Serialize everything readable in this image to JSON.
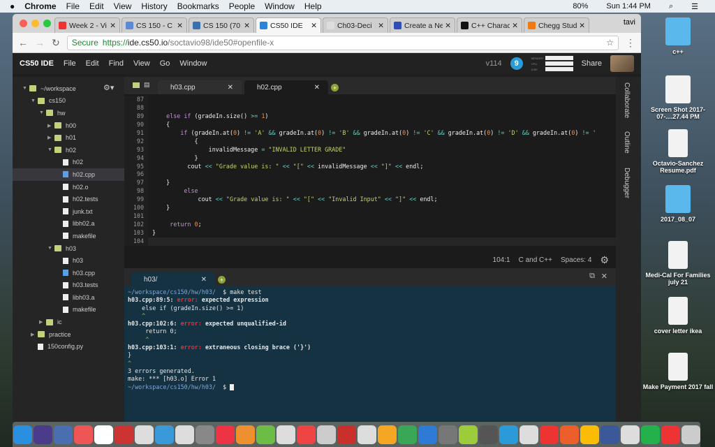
{
  "menubar": {
    "app": "Chrome",
    "items": [
      "File",
      "Edit",
      "View",
      "History",
      "Bookmarks",
      "People",
      "Window",
      "Help"
    ],
    "battery": "80%",
    "clock": "Sun 1:44 PM"
  },
  "browser": {
    "tabs": [
      {
        "title": "Week 2 - Vi",
        "color": "#e33"
      },
      {
        "title": "CS 150 - C",
        "color": "#5b8ad6"
      },
      {
        "title": "CS 150 (70",
        "color": "#3a6fb0"
      },
      {
        "title": "CS50 IDE",
        "color": "#2b83d8",
        "active": true
      },
      {
        "title": "Ch03-Deci",
        "color": "#ddd"
      },
      {
        "title": "Create a Ne",
        "color": "#2f4fb8"
      },
      {
        "title": "C++ Charac",
        "color": "#111"
      },
      {
        "title": "Chegg Stud",
        "color": "#f07a10"
      }
    ],
    "profile": "tavi",
    "secure": "Secure",
    "url_scheme": "https://",
    "url_host": "ide.cs50.io",
    "url_path": "/soctavio98/ide50#openfile-x"
  },
  "ide": {
    "brand": "CS50 IDE",
    "menu": [
      "File",
      "Edit",
      "Find",
      "View",
      "Go",
      "Window"
    ],
    "version": "v114",
    "badge": "9",
    "meters": [
      "MEMORY",
      "CPU",
      "DISK"
    ],
    "share": "Share"
  },
  "tree": [
    {
      "d": 0,
      "a": "▼",
      "t": "folder",
      "label": "~/workspace"
    },
    {
      "d": 1,
      "a": "▼",
      "t": "folder",
      "label": "cs150"
    },
    {
      "d": 2,
      "a": "▼",
      "t": "folder",
      "label": "hw"
    },
    {
      "d": 3,
      "a": "▶",
      "t": "folder",
      "label": "h00"
    },
    {
      "d": 3,
      "a": "▶",
      "t": "folder",
      "label": "h01"
    },
    {
      "d": 3,
      "a": "▼",
      "t": "folder",
      "label": "h02"
    },
    {
      "d": 4,
      "a": "",
      "t": "file",
      "label": "h02"
    },
    {
      "d": 4,
      "a": "",
      "t": "cppfile",
      "label": "h02.cpp",
      "sel": true
    },
    {
      "d": 4,
      "a": "",
      "t": "file",
      "label": "h02.o"
    },
    {
      "d": 4,
      "a": "",
      "t": "file",
      "label": "h02.tests"
    },
    {
      "d": 4,
      "a": "",
      "t": "file",
      "label": "junk.txt"
    },
    {
      "d": 4,
      "a": "",
      "t": "file",
      "label": "libh02.a"
    },
    {
      "d": 4,
      "a": "",
      "t": "file",
      "label": "makefile"
    },
    {
      "d": 3,
      "a": "▼",
      "t": "folder",
      "label": "h03"
    },
    {
      "d": 4,
      "a": "",
      "t": "file",
      "label": "h03"
    },
    {
      "d": 4,
      "a": "",
      "t": "cppfile",
      "label": "h03.cpp"
    },
    {
      "d": 4,
      "a": "",
      "t": "file",
      "label": "h03.tests"
    },
    {
      "d": 4,
      "a": "",
      "t": "file",
      "label": "libh03.a"
    },
    {
      "d": 4,
      "a": "",
      "t": "file",
      "label": "makefile"
    },
    {
      "d": 2,
      "a": "▶",
      "t": "folder",
      "label": "ic"
    },
    {
      "d": 1,
      "a": "▶",
      "t": "folder",
      "label": "practice"
    },
    {
      "d": 1,
      "a": "",
      "t": "file",
      "label": "150config.py"
    }
  ],
  "editor": {
    "tabs": [
      "h03.cpp",
      "h02.cpp"
    ],
    "lines": [
      {
        "n": "87",
        "tok": []
      },
      {
        "n": "88",
        "tok": []
      },
      {
        "n": "89",
        "tok": [
          [
            "tx",
            "    "
          ],
          [
            "kw",
            "else if"
          ],
          [
            "tx",
            " (gradeIn.size() "
          ],
          [
            "op",
            ">="
          ],
          [
            "tx",
            " "
          ],
          [
            "nu",
            "1"
          ],
          [
            "tx",
            ")"
          ]
        ]
      },
      {
        "n": "90",
        "tok": [
          [
            "tx",
            "    {"
          ]
        ]
      },
      {
        "n": "91",
        "tok": [
          [
            "tx",
            "        "
          ],
          [
            "kw",
            "if"
          ],
          [
            "tx",
            " (gradeIn.at("
          ],
          [
            "nu",
            "0"
          ],
          [
            "tx",
            ") "
          ],
          [
            "op",
            "!="
          ],
          [
            "tx",
            " "
          ],
          [
            "st",
            "'A'"
          ],
          [
            "tx",
            " "
          ],
          [
            "op",
            "&&"
          ],
          [
            "tx",
            " gradeIn.at("
          ],
          [
            "nu",
            "0"
          ],
          [
            "tx",
            ") "
          ],
          [
            "op",
            "!="
          ],
          [
            "tx",
            " "
          ],
          [
            "st",
            "'B'"
          ],
          [
            "tx",
            " "
          ],
          [
            "op",
            "&&"
          ],
          [
            "tx",
            " gradeIn.at("
          ],
          [
            "nu",
            "0"
          ],
          [
            "tx",
            ") "
          ],
          [
            "op",
            "!="
          ],
          [
            "tx",
            " "
          ],
          [
            "st",
            "'C'"
          ],
          [
            "tx",
            " "
          ],
          [
            "op",
            "&&"
          ],
          [
            "tx",
            " gradeIn.at("
          ],
          [
            "nu",
            "0"
          ],
          [
            "tx",
            ") "
          ],
          [
            "op",
            "!="
          ],
          [
            "tx",
            " "
          ],
          [
            "st",
            "'D'"
          ],
          [
            "tx",
            " "
          ],
          [
            "op",
            "&&"
          ],
          [
            "tx",
            " gradeIn.at("
          ],
          [
            "nu",
            "0"
          ],
          [
            "tx",
            ") "
          ],
          [
            "op",
            "!="
          ],
          [
            "st",
            " '"
          ]
        ]
      },
      {
        "n": "92",
        "tok": [
          [
            "tx",
            "            {"
          ]
        ]
      },
      {
        "n": "93",
        "tok": [
          [
            "tx",
            "                invalidMessage "
          ],
          [
            "op",
            "="
          ],
          [
            "tx",
            " "
          ],
          [
            "st",
            "\"INVALID LETTER GRADE\""
          ]
        ]
      },
      {
        "n": "94",
        "tok": [
          [
            "tx",
            "            }"
          ]
        ]
      },
      {
        "n": "95",
        "tok": [
          [
            "tx",
            "          cout "
          ],
          [
            "op",
            "<<"
          ],
          [
            "tx",
            " "
          ],
          [
            "st",
            "\"Grade value is: \""
          ],
          [
            "tx",
            " "
          ],
          [
            "op",
            "<<"
          ],
          [
            "tx",
            " "
          ],
          [
            "st",
            "\"[\""
          ],
          [
            "tx",
            " "
          ],
          [
            "op",
            "<<"
          ],
          [
            "tx",
            " invalidMessage "
          ],
          [
            "op",
            "<<"
          ],
          [
            "tx",
            " "
          ],
          [
            "st",
            "\"]\""
          ],
          [
            "tx",
            " "
          ],
          [
            "op",
            "<<"
          ],
          [
            "tx",
            " endl;"
          ]
        ]
      },
      {
        "n": "96",
        "tok": []
      },
      {
        "n": "97",
        "tok": [
          [
            "tx",
            "    }"
          ]
        ]
      },
      {
        "n": "98",
        "tok": [
          [
            "tx",
            "         "
          ],
          [
            "kw",
            "else"
          ]
        ]
      },
      {
        "n": "99",
        "tok": [
          [
            "tx",
            "             cout "
          ],
          [
            "op",
            "<<"
          ],
          [
            "tx",
            " "
          ],
          [
            "st",
            "\"Grade value is: \""
          ],
          [
            "tx",
            " "
          ],
          [
            "op",
            "<<"
          ],
          [
            "tx",
            " "
          ],
          [
            "st",
            "\"[\""
          ],
          [
            "tx",
            " "
          ],
          [
            "op",
            "<<"
          ],
          [
            "tx",
            " "
          ],
          [
            "st",
            "\"Invalid Input\""
          ],
          [
            "tx",
            " "
          ],
          [
            "op",
            "<<"
          ],
          [
            "tx",
            " "
          ],
          [
            "st",
            "\"]\""
          ],
          [
            "tx",
            " "
          ],
          [
            "op",
            "<<"
          ],
          [
            "tx",
            " endl;"
          ]
        ]
      },
      {
        "n": "100",
        "tok": [
          [
            "tx",
            "    }"
          ]
        ]
      },
      {
        "n": "101",
        "tok": []
      },
      {
        "n": "102",
        "tok": [
          [
            "tx",
            "     "
          ],
          [
            "kw",
            "return"
          ],
          [
            "tx",
            " "
          ],
          [
            "nu",
            "0"
          ],
          [
            "tx",
            ";"
          ]
        ]
      },
      {
        "n": "103",
        "tok": [
          [
            "tx",
            "}"
          ]
        ]
      },
      {
        "n": "104",
        "tok": [],
        "cur": true
      }
    ]
  },
  "status": {
    "position": "104:1",
    "language": "C and C++",
    "spaces": "Spaces: 4"
  },
  "terminal": {
    "tab": "h03/",
    "lines": [
      [
        [
          "tp",
          "~/workspace/cs150/hw/h03/"
        ],
        [
          "",
          "  $ make test"
        ]
      ],
      [
        [
          "tb",
          "h03.cpp:89:5: "
        ],
        [
          "terr tb",
          "error: "
        ],
        [
          "tb",
          "expected expression"
        ]
      ],
      [
        [
          "",
          "    else if (gradeIn.size() >= 1)"
        ]
      ],
      [
        [
          "tcar",
          "    ^"
        ]
      ],
      [
        [
          "tb",
          "h03.cpp:102:6: "
        ],
        [
          "terr tb",
          "error: "
        ],
        [
          "tb",
          "expected unqualified-id"
        ]
      ],
      [
        [
          "",
          "     return 0;"
        ]
      ],
      [
        [
          "tcar",
          "     ^"
        ]
      ],
      [
        [
          "tb",
          "h03.cpp:103:1: "
        ],
        [
          "terr tb",
          "error: "
        ],
        [
          "tb",
          "extraneous closing brace ('}')"
        ]
      ],
      [
        [
          "",
          "}"
        ]
      ],
      [
        [
          "tcar",
          "^"
        ]
      ],
      [
        [
          "",
          "3 errors generated."
        ]
      ],
      [
        [
          "",
          "make: *** [h03.o] Error 1"
        ]
      ],
      [
        [
          "tp",
          "~/workspace/cs150/hw/h03/"
        ],
        [
          "",
          "  $ "
        ]
      ]
    ]
  },
  "rpanel": [
    "Collaborate",
    "Outline",
    "Debugger"
  ],
  "desktop": [
    {
      "label": "c++",
      "kind": "folder"
    },
    {
      "label": "Screen Shot 2017-07-....27.44 PM",
      "kind": "shot"
    },
    {
      "label": "Octavio-Sanchez Resume.pdf",
      "kind": "doc"
    },
    {
      "label": "2017_08_07",
      "kind": "folder"
    },
    {
      "label": "Medi-Cal For Families july 21",
      "kind": "doc"
    },
    {
      "label": "cover letter ikea",
      "kind": "doc"
    },
    {
      "label": "Make Payment 2017 fall",
      "kind": "doc"
    }
  ]
}
